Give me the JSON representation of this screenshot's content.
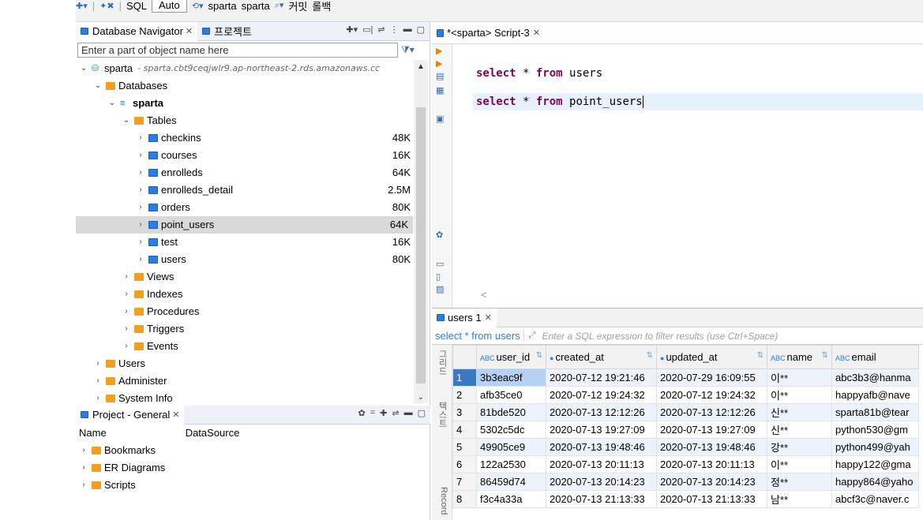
{
  "toolbar": {
    "sql_label": "SQL",
    "auto_label": "Auto",
    "ds1": "sparta",
    "ds2": "sparta",
    "commit_label": "커밋",
    "rollback_label": "롤백"
  },
  "left": {
    "tabs": [
      {
        "label": "Database Navigator"
      },
      {
        "label": "프로젝트"
      }
    ],
    "filter_placeholder": "Enter a part of object name here",
    "connection": {
      "name": "sparta",
      "host": "sparta.cbt9ceqjwlr9.ap-northeast-2.rds.amazonaws.cc"
    },
    "databases_label": "Databases",
    "schema": "sparta",
    "tables_label": "Tables",
    "tables": [
      {
        "name": "checkins",
        "size": "48K"
      },
      {
        "name": "courses",
        "size": "16K"
      },
      {
        "name": "enrolleds",
        "size": "64K"
      },
      {
        "name": "enrolleds_detail",
        "size": "2.5M"
      },
      {
        "name": "orders",
        "size": "80K"
      },
      {
        "name": "point_users",
        "size": "64K"
      },
      {
        "name": "test",
        "size": "16K"
      },
      {
        "name": "users",
        "size": "80K"
      }
    ],
    "folders": [
      "Views",
      "Indexes",
      "Procedures",
      "Triggers",
      "Events"
    ],
    "top_level": [
      "Users",
      "Administer",
      "System Info"
    ]
  },
  "project": {
    "tab_label": "Project - General",
    "col_name": "Name",
    "col_datasource": "DataSource",
    "items": [
      "Bookmarks",
      "ER Diagrams",
      "Scripts"
    ]
  },
  "editor": {
    "tab_label": "*<sparta> Script-3",
    "lines": [
      {
        "kw1": "select",
        "mid": " * ",
        "kw2": "from",
        "rest": " users"
      },
      {
        "kw1": "select",
        "mid": " * ",
        "kw2": "from",
        "rest": " point_users"
      }
    ]
  },
  "results": {
    "tab_label": "users 1",
    "query": "select * from users",
    "filter_placeholder": "Enter a SQL expression to filter results (use Ctrl+Space)",
    "side_tabs": [
      "그리드",
      "텍스트",
      "Record"
    ],
    "columns": [
      "user_id",
      "created_at",
      "updated_at",
      "name",
      "email"
    ],
    "rows": [
      {
        "n": "1",
        "user_id": "3b3eac9f",
        "created_at": "2020-07-12 19:21:46",
        "updated_at": "2020-07-29 16:09:55",
        "name": "이**",
        "email": "abc3b3@hanma"
      },
      {
        "n": "2",
        "user_id": "afb35ce0",
        "created_at": "2020-07-12 19:24:32",
        "updated_at": "2020-07-12 19:24:32",
        "name": "이**",
        "email": "happyafb@nave"
      },
      {
        "n": "3",
        "user_id": "81bde520",
        "created_at": "2020-07-13 12:12:26",
        "updated_at": "2020-07-13 12:12:26",
        "name": "신**",
        "email": "sparta81b@tear"
      },
      {
        "n": "4",
        "user_id": "5302c5dc",
        "created_at": "2020-07-13 19:27:09",
        "updated_at": "2020-07-13 19:27:09",
        "name": "신**",
        "email": "python530@gm"
      },
      {
        "n": "5",
        "user_id": "49905ce9",
        "created_at": "2020-07-13 19:48:46",
        "updated_at": "2020-07-13 19:48:46",
        "name": "강**",
        "email": "python499@yah"
      },
      {
        "n": "6",
        "user_id": "122a2530",
        "created_at": "2020-07-13 20:11:13",
        "updated_at": "2020-07-13 20:11:13",
        "name": "이**",
        "email": "happy122@gma"
      },
      {
        "n": "7",
        "user_id": "86459d74",
        "created_at": "2020-07-13 20:14:23",
        "updated_at": "2020-07-13 20:14:23",
        "name": "정**",
        "email": "happy864@yaho"
      },
      {
        "n": "8",
        "user_id": "f3c4a33a",
        "created_at": "2020-07-13 21:13:33",
        "updated_at": "2020-07-13 21:13:33",
        "name": "남**",
        "email": "abcf3c@naver.c"
      }
    ]
  }
}
